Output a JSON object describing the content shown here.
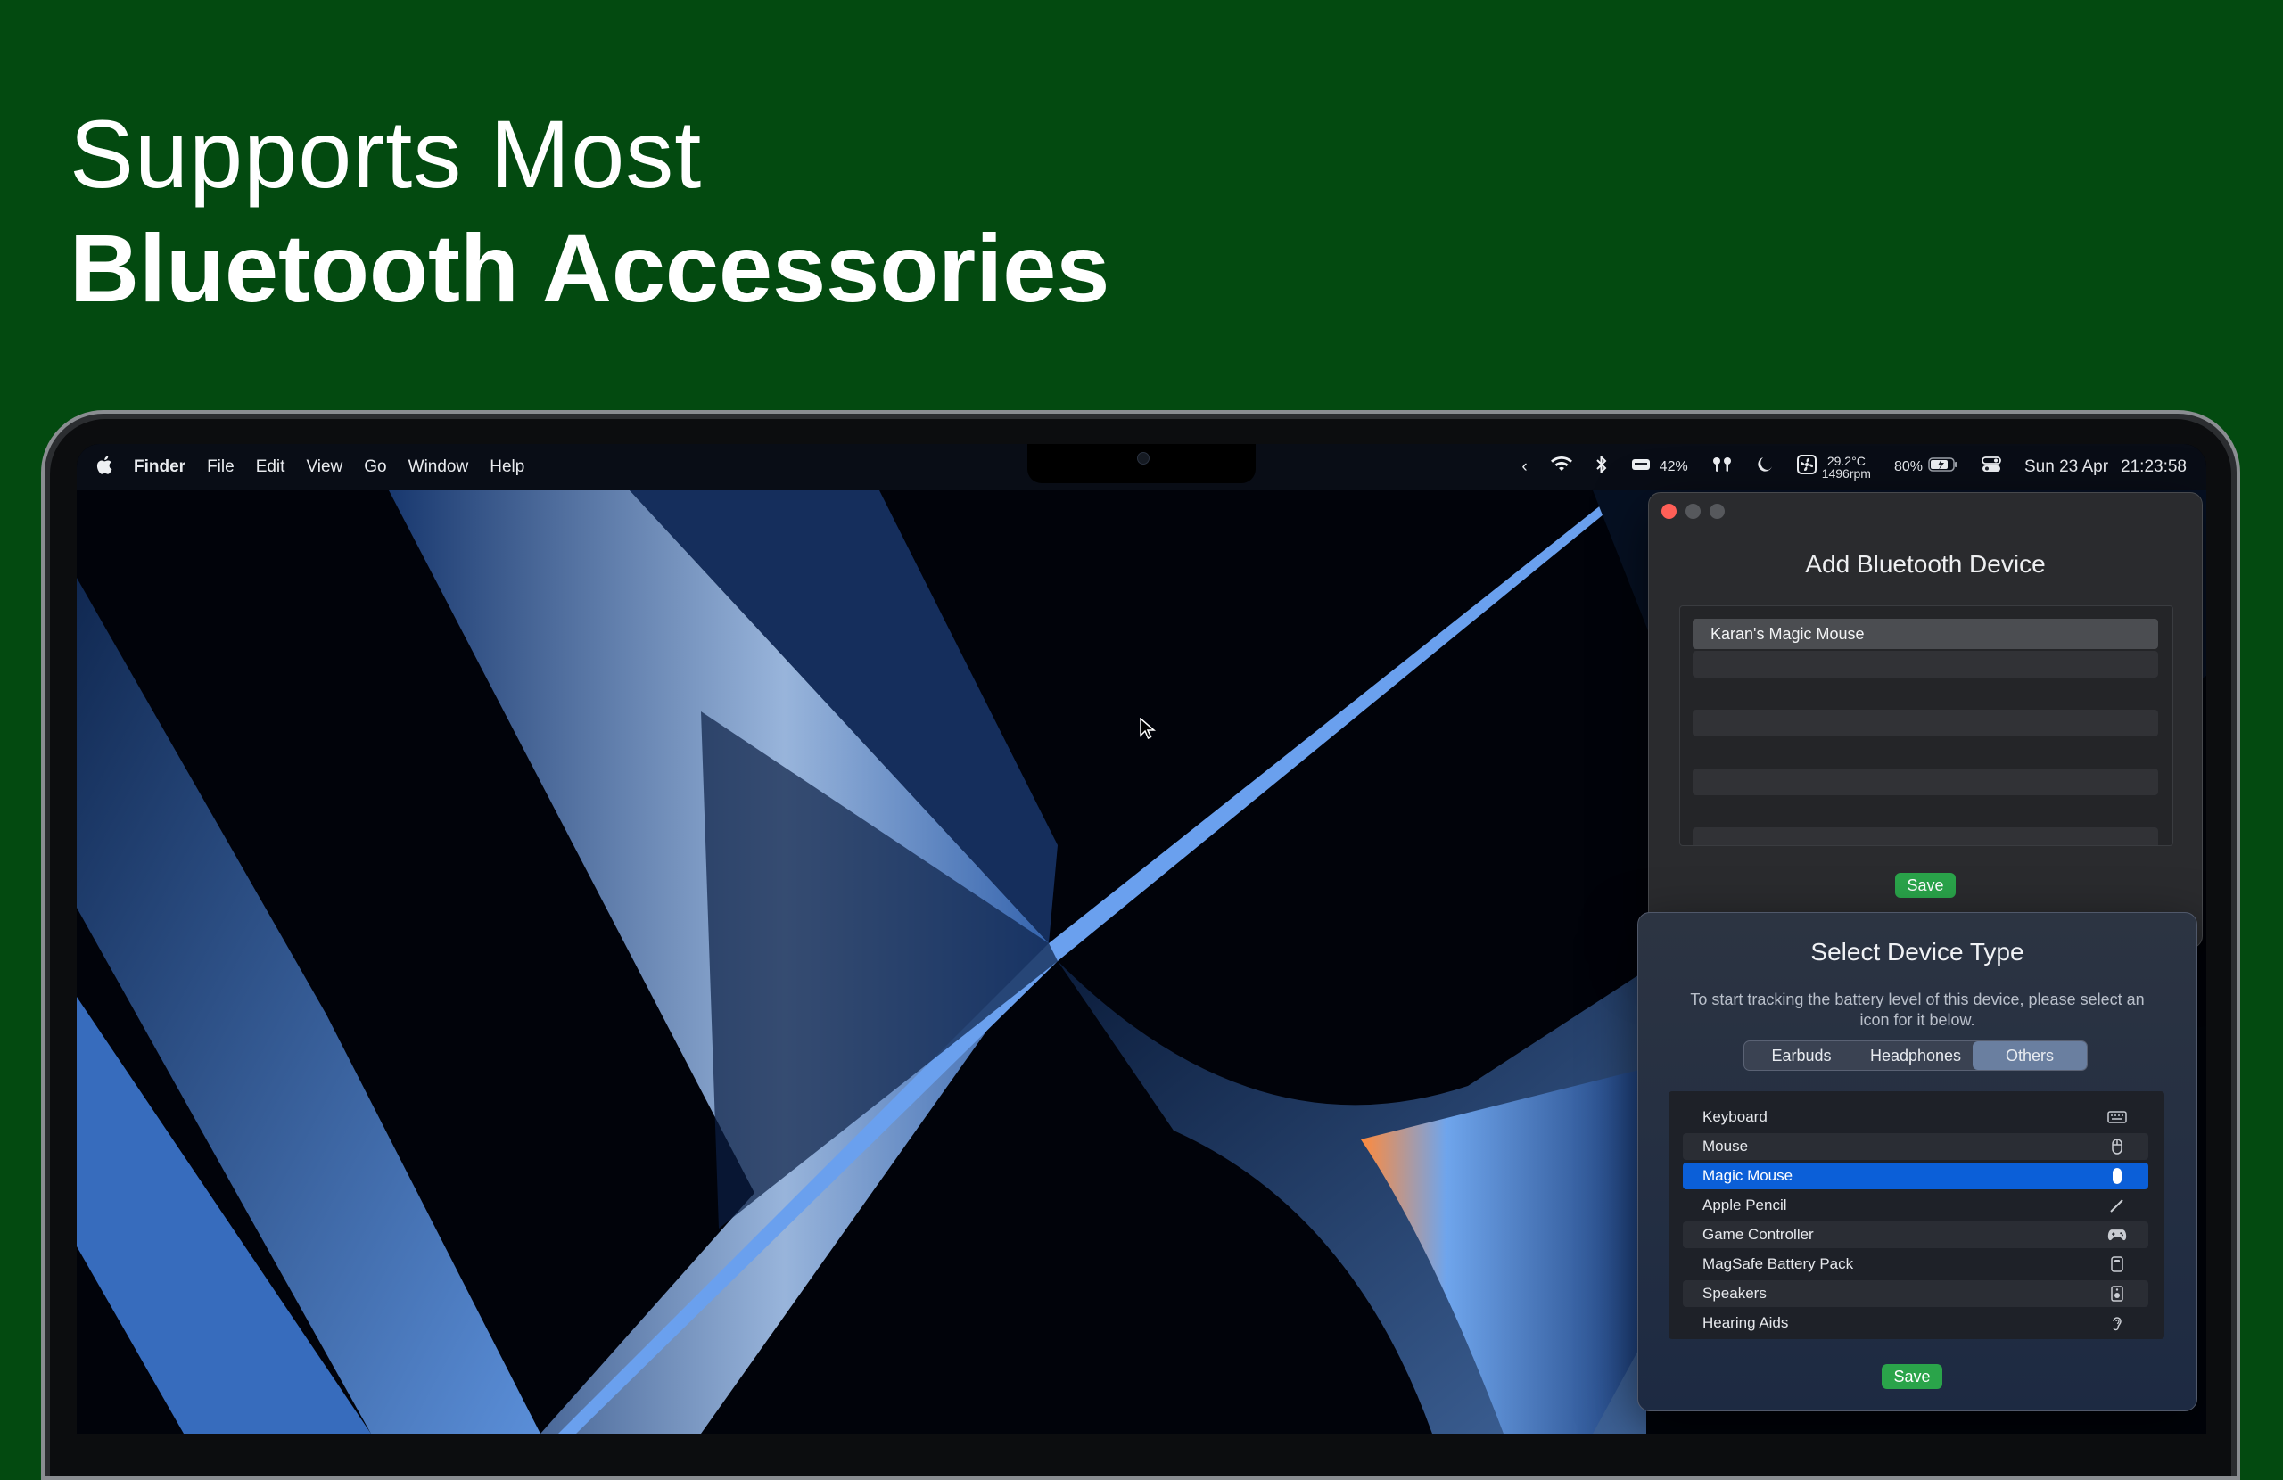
{
  "headline": {
    "line1": "Supports Most",
    "line2": "Bluetooth Accessories"
  },
  "menubar": {
    "apple": "",
    "app_name": "Finder",
    "menus": [
      "File",
      "Edit",
      "View",
      "Go",
      "Window",
      "Help"
    ],
    "status": {
      "battery_device": "42%",
      "temp": "29.2°C",
      "rpm": "1496rpm",
      "battery": "80%",
      "date": "Sun 23 Apr",
      "time": "21:23:58"
    },
    "icons": [
      "chevron-left-icon",
      "wifi-icon",
      "bluetooth-icon",
      "device-battery-icon",
      "airpods-icon",
      "moon-icon",
      "fan-icon",
      "battery-icon",
      "control-center-icon"
    ]
  },
  "add_window": {
    "title": "Add Bluetooth Device",
    "devices": [
      "Karan's Magic Mouse"
    ],
    "save": "Save"
  },
  "type_window": {
    "title": "Select Device Type",
    "description": "To start tracking the battery level of this device, please select an icon for it below.",
    "tabs": [
      "Earbuds",
      "Headphones",
      "Others"
    ],
    "selected_tab": "Others",
    "items": [
      {
        "label": "Keyboard",
        "icon": "keyboard-icon"
      },
      {
        "label": "Mouse",
        "icon": "mouse-icon"
      },
      {
        "label": "Magic Mouse",
        "icon": "magic-mouse-icon"
      },
      {
        "label": "Apple Pencil",
        "icon": "pencil-icon"
      },
      {
        "label": "Game Controller",
        "icon": "gamecontroller-icon"
      },
      {
        "label": "MagSafe Battery Pack",
        "icon": "battery-pack-icon"
      },
      {
        "label": "Speakers",
        "icon": "speaker-icon"
      },
      {
        "label": "Hearing Aids",
        "icon": "ear-icon"
      }
    ],
    "selected_item": "Magic Mouse",
    "save": "Save"
  },
  "colors": {
    "background": "#034a10",
    "accent_green": "#2aa44a",
    "selection_blue": "#0b5fd8",
    "close_red": "#ff5f57"
  }
}
